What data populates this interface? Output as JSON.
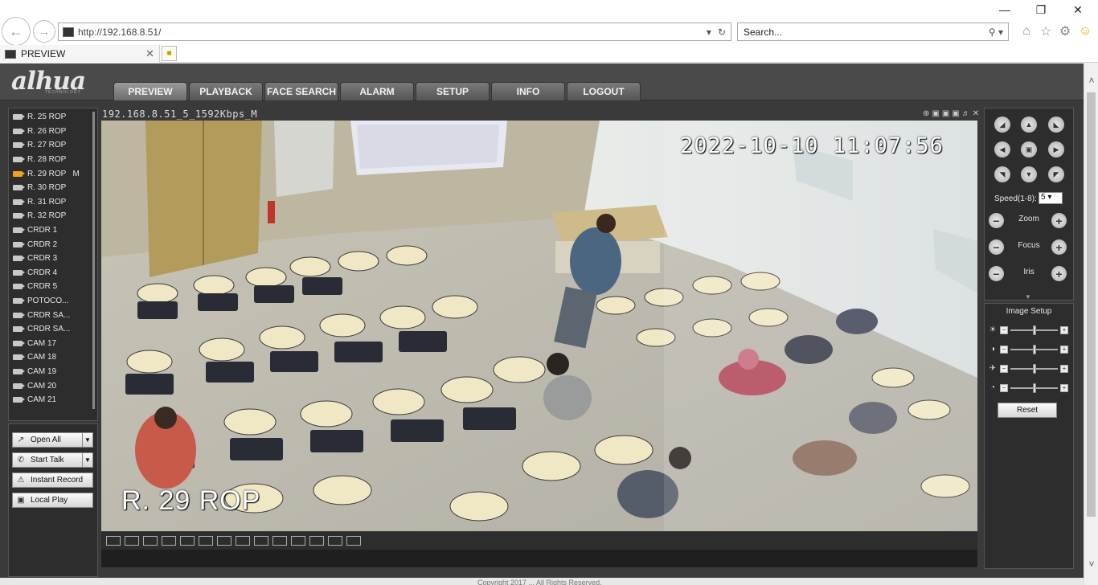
{
  "browser": {
    "url": "http://192.168.8.51/",
    "search_placeholder": "Search...",
    "tab_title": "PREVIEW"
  },
  "app": {
    "logo": "alhua",
    "logo_sub": "TECHNOLOGY",
    "nav": [
      {
        "label": "PREVIEW",
        "active": true
      },
      {
        "label": "PLAYBACK"
      },
      {
        "label": "FACE SEARCH"
      },
      {
        "label": "ALARM"
      },
      {
        "label": "SETUP"
      },
      {
        "label": "INFO"
      },
      {
        "label": "LOGOUT"
      }
    ]
  },
  "devices": [
    {
      "label": "R. 25 ROP"
    },
    {
      "label": "R. 26 ROP"
    },
    {
      "label": "R. 27 ROP"
    },
    {
      "label": "R. 28 ROP"
    },
    {
      "label": "R. 29 ROP   M",
      "active": true
    },
    {
      "label": "R. 30 ROP"
    },
    {
      "label": "R. 31 ROP"
    },
    {
      "label": "R. 32 ROP"
    },
    {
      "label": "CRDR 1"
    },
    {
      "label": "CRDR 2"
    },
    {
      "label": "CRDR 3"
    },
    {
      "label": "CRDR 4"
    },
    {
      "label": "CRDR 5"
    },
    {
      "label": "POTOCO..."
    },
    {
      "label": "CRDR SA..."
    },
    {
      "label": "CRDR SA..."
    },
    {
      "label": "CAM 17"
    },
    {
      "label": "CAM 18"
    },
    {
      "label": "CAM 19"
    },
    {
      "label": "CAM 20"
    },
    {
      "label": "CAM 21"
    }
  ],
  "controls": {
    "open_all": "Open All",
    "start_talk": "Start Talk",
    "instant_record": "Instant Record",
    "local_play": "Local Play"
  },
  "video": {
    "stream_title": "192.168.8.51_5_1592Kbps_M",
    "osd_time": "2022-10-10 11:07:56",
    "osd_name": "R. 29 ROP"
  },
  "layouts": [
    "1x1",
    "2x2",
    "full",
    "wide",
    "1",
    "4",
    "6",
    "8",
    "9",
    "13",
    "16",
    "20",
    "25",
    "36"
  ],
  "ptz": {
    "speed_label": "Speed(1-8):",
    "speed_value": "5",
    "zoom_label": "Zoom",
    "focus_label": "Focus",
    "iris_label": "Iris"
  },
  "image_setup": {
    "title": "Image Setup",
    "reset_label": "Reset",
    "sliders": [
      {
        "icon": "brightness-icon",
        "value": 0.5
      },
      {
        "icon": "contrast-icon",
        "value": 0.5
      },
      {
        "icon": "saturation-icon",
        "value": 0.5
      },
      {
        "icon": "hue-icon",
        "value": 0.5
      }
    ]
  },
  "footer": {
    "text": "Copyright 2017 ... All Rights Reserved."
  }
}
